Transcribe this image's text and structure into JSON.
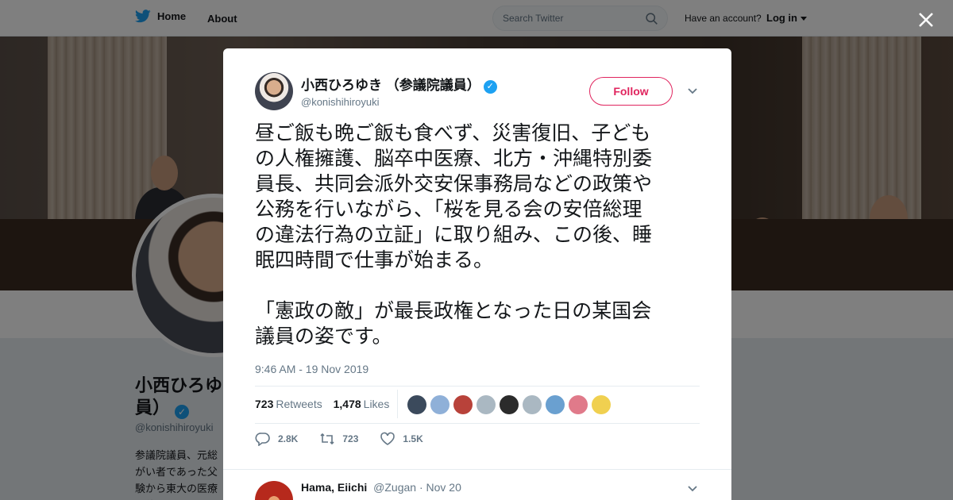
{
  "topbar": {
    "home_label": "Home",
    "about_label": "About",
    "search_placeholder": "Search Twitter",
    "account_question": "Have an account?",
    "login_label": "Log in"
  },
  "profile": {
    "name": "小西ひろゆき（参議院議員）",
    "name_visible": "小西ひろゆ\n員）",
    "handle": "@konishihiroyuki",
    "bio_visible": "参議院議員、元総\nがい者であった父\n験から東大の医療\n団体の皆さんなど"
  },
  "tweet": {
    "author_name": "小西ひろゆき （参議院議員）",
    "author_handle": "@konishihiroyuki",
    "verified": true,
    "follow_label": "Follow",
    "text": "昼ご飯も晩ご飯も食べず、災害復旧、子ども\nの人権擁護、脳卒中医療、北方・沖縄特別委\n員長、共同会派外交安保事務局などの政策や\n公務を行いながら、「桜を見る会の安倍総理\nの違法行為の立証」に取り組み、この後、睡\n眠四時間で仕事が始まる。\n\n「憲政の敵」が最長政権となった日の某国会\n議員の姿です。",
    "timestamp": "9:46 AM - 19 Nov 2019",
    "retweets_count": "723",
    "retweets_label": "Retweets",
    "likes_count": "1,478",
    "likes_label": "Likes",
    "reply_count": "2.8K",
    "retweet_action_count": "723",
    "like_action_count": "1.5K",
    "liker_avatars": [
      "#3b4a5c",
      "#8fb0d8",
      "#b8423a",
      "#aab8c2",
      "#2b2b2b",
      "#aab8c2",
      "#6aa0d0",
      "#e07a8a",
      "#f0d050"
    ]
  },
  "reply": {
    "author_name": "Hama, Eiichi",
    "author_handle": "@Zugan",
    "date": "· Nov 20"
  },
  "colors": {
    "twitter_blue": "#1da1f2",
    "follow_red": "#e0245e",
    "text_dark": "#14171a",
    "text_gray": "#657786"
  }
}
